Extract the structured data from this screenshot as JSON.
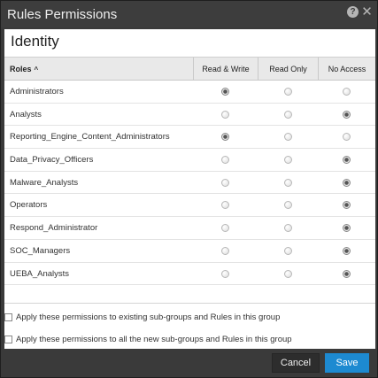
{
  "window": {
    "title": "Rules Permissions"
  },
  "panel": {
    "section_title": "Identity"
  },
  "table": {
    "headers": {
      "roles": "Roles",
      "read_write": "Read & Write",
      "read_only": "Read Only",
      "no_access": "No Access"
    },
    "rows": [
      {
        "role": "Administrators",
        "permission": "read_write"
      },
      {
        "role": "Analysts",
        "permission": "no_access"
      },
      {
        "role": "Reporting_Engine_Content_Administrators",
        "permission": "read_write"
      },
      {
        "role": "Data_Privacy_Officers",
        "permission": "no_access"
      },
      {
        "role": "Malware_Analysts",
        "permission": "no_access"
      },
      {
        "role": "Operators",
        "permission": "no_access"
      },
      {
        "role": "Respond_Administrator",
        "permission": "no_access"
      },
      {
        "role": "SOC_Managers",
        "permission": "no_access"
      },
      {
        "role": "UEBA_Analysts",
        "permission": "no_access"
      }
    ]
  },
  "options": {
    "existing_subgroups": {
      "label": "Apply these permissions to existing sub-groups and Rules in this group",
      "checked": false
    },
    "new_subgroups": {
      "label": "Apply these permissions to all the new sub-groups and Rules in this group",
      "checked": false
    }
  },
  "footer": {
    "cancel_label": "Cancel",
    "save_label": "Save"
  },
  "colors": {
    "accent": "#1d8ad1",
    "titlebar": "#3d3d3d",
    "header_bg": "#e9e9e9"
  },
  "icons": {
    "help": "help-icon",
    "close": "close-icon",
    "sort": "sort-ascending-icon"
  }
}
